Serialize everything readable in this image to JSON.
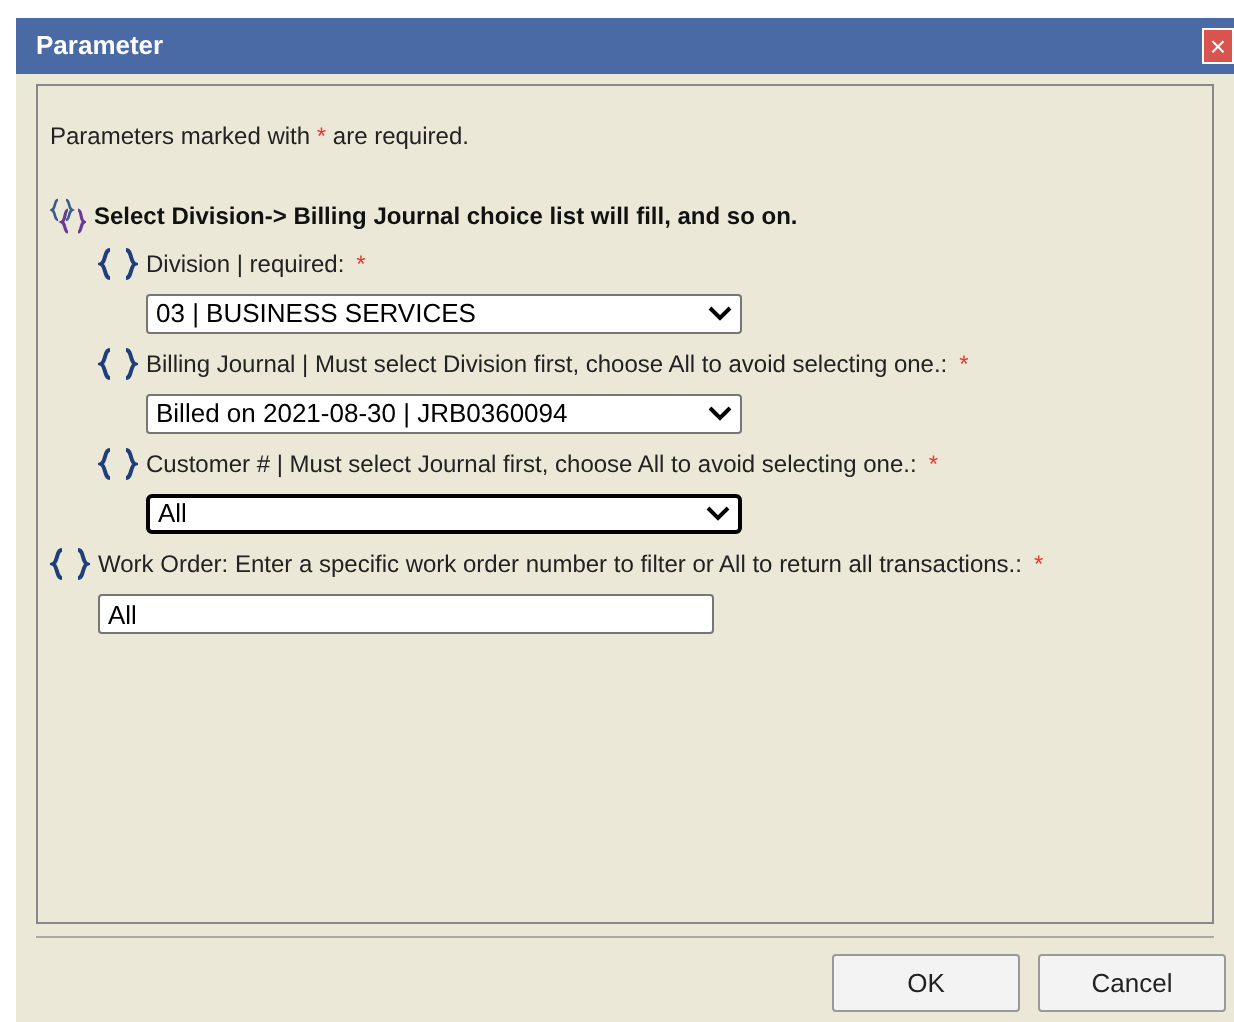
{
  "window": {
    "title": "Parameter",
    "close": "×"
  },
  "intro": {
    "before": "Parameters marked with",
    "mark": "*",
    "after": "are required."
  },
  "parameters": [
    {
      "kind": "group",
      "label": "Select Division-> Billing Journal choice list will fill, and so on.",
      "children": [
        {
          "kind": "select",
          "label": "Division | required:",
          "required": true,
          "value": "03 | BUSINESS SERVICES",
          "focused": false
        },
        {
          "kind": "select",
          "label": "Billing Journal | Must select Division first, choose All to avoid selecting one.:",
          "required": true,
          "value": "Billed on 2021-08-30 | JRB0360094",
          "focused": false
        },
        {
          "kind": "select",
          "label": "Customer # | Must select Journal first, choose All to avoid selecting one.:",
          "required": true,
          "value": "All",
          "focused": true
        }
      ]
    },
    {
      "kind": "input",
      "label": "Work Order: Enter a specific work order number to filter or All to return all transactions.:",
      "required": true,
      "value": "All",
      "focused": false
    }
  ],
  "required_mark": "*",
  "buttons": [
    "OK",
    "Cancel"
  ]
}
